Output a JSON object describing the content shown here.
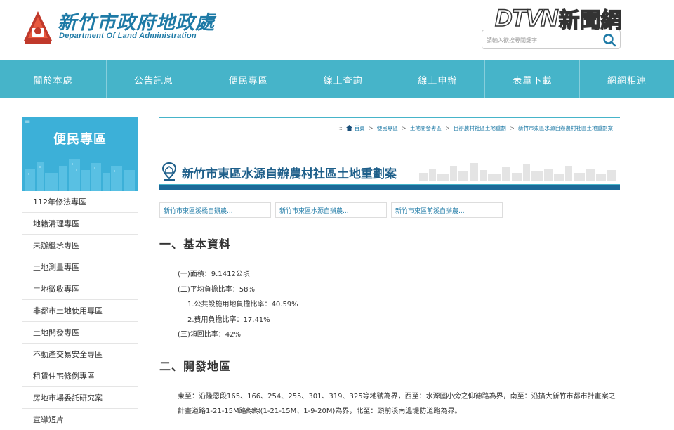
{
  "header": {
    "site_title": "新竹市政府地政處",
    "site_subtitle": "Department Of Land Administration",
    "news_logo_letters": "DTVN",
    "news_logo_cn": "新聞網",
    "search_placeholder": "請輸入欲搜尋關鍵字",
    "search_icon": "search-icon"
  },
  "nav": {
    "items": [
      "關於本處",
      "公告訊息",
      "便民專區",
      "線上查詢",
      "線上申辦",
      "表單下載",
      "網網相連"
    ]
  },
  "sidebar": {
    "banner_title": "便民專區",
    "banner_dots": "=",
    "items": [
      "112年修法專區",
      "地籍清理專區",
      "未辦繼承專區",
      "土地測量專區",
      "土地徵收專區",
      "非都市土地使用專區",
      "土地開發專區",
      "不動產交易安全專區",
      "租賃住宅條例專區",
      "房地市場委託研究案",
      "宣導短片"
    ]
  },
  "breadcrumb": {
    "prefix": ":::",
    "items": [
      "首頁",
      "便民專區",
      "土地開發專區",
      "自辦農村社區土地重劃",
      "新竹市東區水源自辦農村社區土地重劃案"
    ],
    "separator": ">"
  },
  "main": {
    "page_title": "新竹市東區水源自辦農村社區土地重劃案",
    "tabs": [
      "新竹市東區溪橋自辦農...",
      "新竹市東區水源自辦農...",
      "新竹市東區前溪自辦農..."
    ],
    "section1_title": "一、基本資料",
    "info_lines": [
      "(一)面積：9.1412公頃",
      "(二)平均負擔比率：58%",
      "1.公共設施用地負擔比率：40.59%",
      "2.費用負擔比率：17.41%",
      "(三)領回比率：42%"
    ],
    "section2_title": "二、開發地區",
    "description": "東至：沿隆恩段165、166、254、255、301、319、325等地號為界，西至：水源國小旁之仰德路為界，南至：沿擴大新竹市都市計畫案之計畫道路1-21-15M路線線(1-21-15M、1-9-20M)為界，北至：頭前溪南邊堤防道路為界。"
  },
  "colors": {
    "brand_blue": "#1e7aa6",
    "nav_teal": "#46b4c9",
    "banner_blue": "#3cb0d8",
    "title_bar": "#1b6a99"
  }
}
